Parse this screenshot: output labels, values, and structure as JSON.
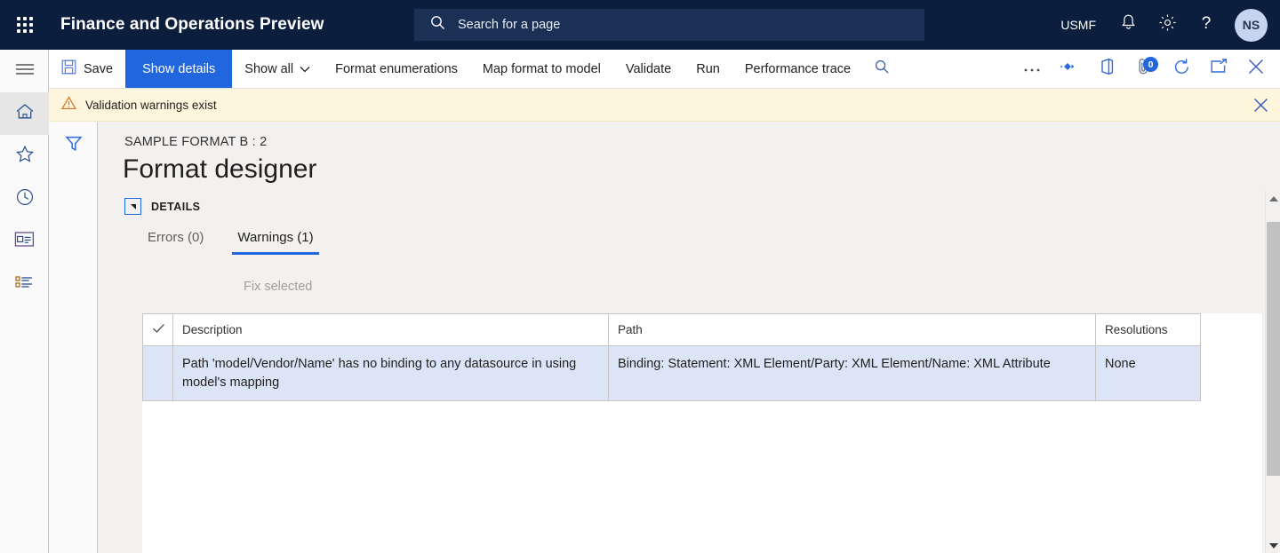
{
  "topbar": {
    "waffle_label": "app-launcher",
    "app_title": "Finance and Operations Preview",
    "search": {
      "placeholder": "Search for a page",
      "value": ""
    },
    "company": "USMF",
    "icons": [
      "notifications-bell-icon",
      "settings-gear-icon",
      "help-question-icon"
    ],
    "avatar_initials": "NS",
    "accent": "#0b1e3d"
  },
  "rail": {
    "items": [
      {
        "name": "hamburger-menu",
        "icon": "hamburger-icon",
        "active": false
      },
      {
        "name": "home",
        "icon": "home-icon",
        "active": true
      },
      {
        "name": "favorites",
        "icon": "star-icon",
        "active": false
      },
      {
        "name": "recent",
        "icon": "clock-icon",
        "active": false
      },
      {
        "name": "workspaces",
        "icon": "workspace-icon",
        "active": false
      },
      {
        "name": "modules",
        "icon": "list-icon",
        "active": false
      }
    ]
  },
  "commandbar": {
    "save_label": "Save",
    "show_details_label": "Show details",
    "show_all_label": "Show all",
    "format_enumerations_label": "Format enumerations",
    "map_format_to_model_label": "Map format to model",
    "validate_label": "Validate",
    "run_label": "Run",
    "performance_trace_label": "Performance trace",
    "search_icon": "search-icon",
    "right_icons": [
      {
        "name": "overflow-more-icon",
        "label": "..."
      },
      {
        "name": "share-icon",
        "label": ""
      },
      {
        "name": "office-app-icon",
        "label": ""
      },
      {
        "name": "attachments-icon",
        "badge": "0"
      },
      {
        "name": "refresh-icon",
        "label": ""
      },
      {
        "name": "open-in-new-window-icon",
        "label": ""
      },
      {
        "name": "close-icon",
        "label": ""
      }
    ],
    "primary_accent": "#2266dd"
  },
  "warning_banner": {
    "icon": "warning-triangle-icon",
    "message": "Validation warnings exist",
    "close_icon": "close-icon",
    "background": "#fdf6dd"
  },
  "filter_panel": {
    "filter_icon": "filter-funnel-icon"
  },
  "page": {
    "breadcrumb": "SAMPLE FORMAT B : 2",
    "title": "Format designer",
    "details_section": {
      "collapse_glyph": "◢",
      "label": "DETAILS"
    },
    "tabs": [
      {
        "label": "Errors (0)",
        "active": false
      },
      {
        "label": "Warnings (1)",
        "active": true
      }
    ],
    "fix_selected_label": "Fix selected"
  },
  "grid": {
    "select_all_icon": "checkmark-icon",
    "columns": [
      "Description",
      "Path",
      "Resolutions"
    ],
    "rows": [
      {
        "selected": true,
        "description": "Path 'model/Vendor/Name' has no binding to any datasource in using model's mapping",
        "path": "Binding: Statement: XML Element/Party: XML Element/Name: XML Attribute",
        "resolutions": "None"
      }
    ],
    "row_selected_color": "#dbe5f7"
  },
  "scrollbar": {
    "up_icon": "scroll-up-arrow-icon",
    "down_icon": "scroll-down-arrow-icon",
    "thumb": "scroll-thumb"
  }
}
